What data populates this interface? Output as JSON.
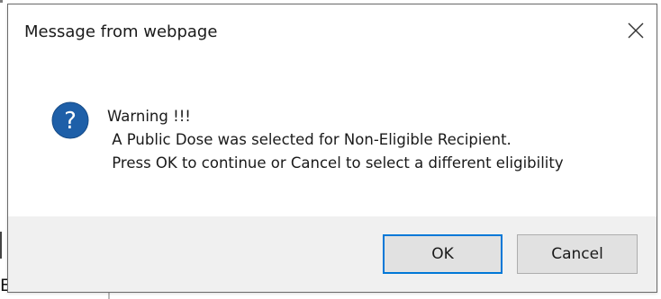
{
  "dialog": {
    "title": "Message from webpage",
    "close_icon": "close-icon",
    "icon": "question-icon",
    "icon_glyph": "?",
    "message_lines": [
      "Warning !!!",
      " A Public Dose was selected for Non-Eligible Recipient.",
      " Press OK to continue or Cancel to select a different eligibility"
    ],
    "buttons": {
      "ok_label": "OK",
      "cancel_label": "Cancel"
    }
  },
  "background": {
    "partial_letter": "E"
  },
  "colors": {
    "accent": "#0078d7",
    "icon_fill": "#1e5fa8",
    "footer_bg": "#f0f0f0",
    "button_bg": "#e1e1e1"
  }
}
